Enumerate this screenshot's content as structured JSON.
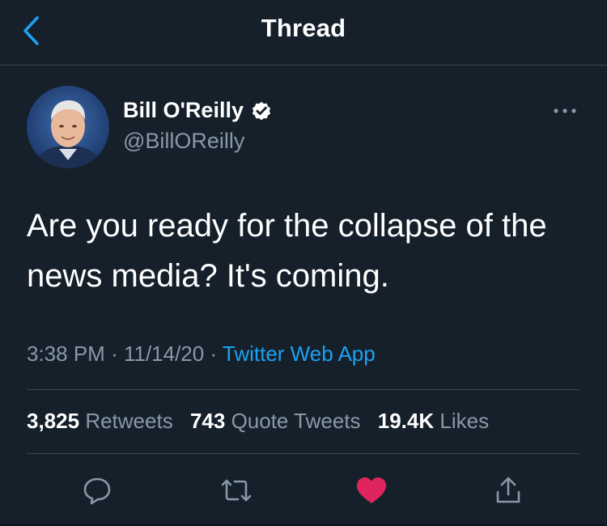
{
  "header": {
    "title": "Thread",
    "back_icon": "chevron-left-icon"
  },
  "tweet": {
    "author_name": "Bill O'Reilly",
    "author_handle": "@BillOReilly",
    "verified": true,
    "text": "Are you ready for the collapse of the news media? It's coming.",
    "time": "3:38 PM",
    "date": "11/14/20",
    "source": "Twitter Web App",
    "retweets_count": "3,825",
    "retweets_label": "Retweets",
    "quote_count": "743",
    "quote_label": "Quote Tweets",
    "likes_count": "19.4K",
    "likes_label": "Likes",
    "liked": true
  },
  "actions": [
    "reply-icon",
    "retweet-icon",
    "like-icon",
    "share-icon"
  ],
  "colors": {
    "background": "#15202b",
    "divider": "#38444d",
    "secondary_text": "#8899a6",
    "accent": "#1da1f2",
    "like": "#e0245e"
  }
}
